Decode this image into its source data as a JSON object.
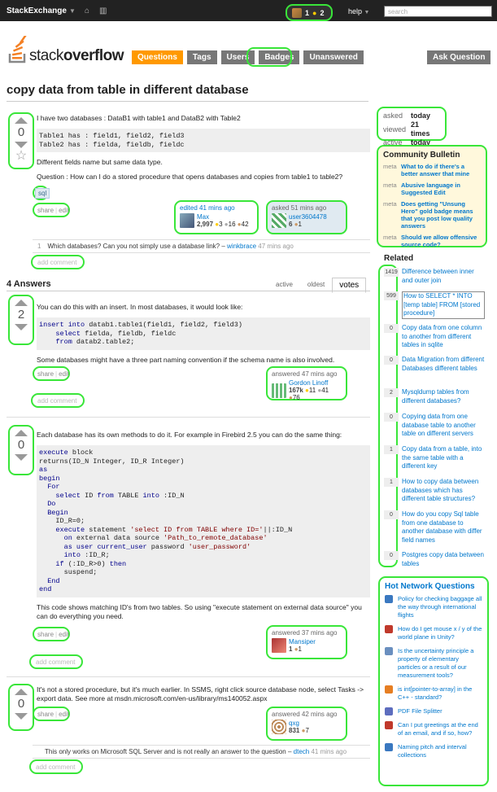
{
  "topbar": {
    "brand": "StackExchange",
    "rep": "1",
    "badges": "2",
    "help": "help",
    "search_placeholder": "search"
  },
  "logo": {
    "prefix": "stack",
    "suffix": "overflow"
  },
  "nav": {
    "questions": "Questions",
    "tags": "Tags",
    "users": "Users",
    "badges": "Badges",
    "unanswered": "Unanswered",
    "ask": "Ask Question"
  },
  "question": {
    "title": "copy data from table in different database",
    "votes": "0",
    "p1": "I have two databases : DataB1 with table1 and DataB2 with Table2",
    "code": "Table1 has : field1, field2, field3\nTable2 has : fielda, fieldb, fieldc",
    "p2": "Different fields name but same data type.",
    "p3": "Question : How can I do a stored procedure that opens databases and copies from table1 to table2?",
    "tag": "sql",
    "share": "share",
    "edit": "edit",
    "edited": {
      "when": "edited 41 mins ago",
      "user": "Max",
      "rep": "2,997",
      "gold": "3",
      "silver": "16",
      "bronze": "42"
    },
    "asked": {
      "when": "asked 51 mins ago",
      "user": "user3604478",
      "rep": "6",
      "bronze": "1"
    },
    "comment": {
      "score": "1",
      "text": "Which databases? Can you not simply use a database link? –",
      "user": "winkbrace",
      "when": "47 mins ago"
    },
    "add_comment": "add comment"
  },
  "answers_header": "4 Answers",
  "tabs": {
    "active": "active",
    "oldest": "oldest",
    "votes": "votes"
  },
  "answers": [
    {
      "votes": "2",
      "p1": "You can do this with an insert. In most databases, it would look like:",
      "p2": "Some databases might have a three part naming convention if the schema name is also involved.",
      "card": {
        "when": "answered 47 mins ago",
        "user": "Gordon Linoff",
        "rep": "167k",
        "gold": "11",
        "silver": "41",
        "bronze": "76"
      }
    },
    {
      "votes": "0",
      "p1": "Each database has its own methods to do it. For example in Firebird 2.5 you can do the same thing:",
      "p2": "This code shows matching ID's from two tables. So using \"execute statement on external data source\" you can do everything you need.",
      "card": {
        "when": "answered 37 mins ago",
        "user": "Mansiper",
        "rep": "1",
        "bronze": "1"
      }
    },
    {
      "votes": "0",
      "p1": "It's not a stored procedure, but it's much earlier. In SSMS, right click source database node, select Tasks -> export data. See more at msdn.microsoft.com/en-us/library/ms140052.aspx",
      "card": {
        "when": "answered 42 mins ago",
        "user": "qxg",
        "rep": "831",
        "bronze": "7"
      },
      "comment": {
        "text": "This only works on Microsoft SQL Server and is not really an answer to the question –",
        "user": "dtech",
        "when": "41 mins ago"
      }
    }
  ],
  "stats": {
    "asked_k": "asked",
    "asked_v": "today",
    "viewed_k": "viewed",
    "viewed_v": "21 times",
    "active_k": "active",
    "active_v": "today"
  },
  "bulletin": {
    "title": "Community Bulletin",
    "items": [
      {
        "meta": "meta",
        "text": "What to do if there's a better answer that mine"
      },
      {
        "meta": "meta",
        "text": "Abusive language in Suggested Edit"
      },
      {
        "meta": "meta",
        "text": "Does getting \"Unsung Hero\" gold badge means that you post low quality answers"
      },
      {
        "meta": "meta",
        "text": "Should we allow offensive source code?"
      }
    ]
  },
  "related": {
    "title": "Related",
    "items": [
      {
        "count": "1419",
        "text": "Difference between inner and outer join"
      },
      {
        "count": "599",
        "text": "How to SELECT * INTO [temp table] FROM [stored procedure]"
      },
      {
        "count": "0",
        "text": "Copy data from one column to another from different tables in sqlite"
      },
      {
        "count": "0",
        "text": "Data Migration from different Databases different tables"
      },
      {
        "count": "2",
        "text": "Mysqldump tables from different databases?"
      },
      {
        "count": "0",
        "text": "Copying data from one database table to another table on different servers"
      },
      {
        "count": "1",
        "text": "Copy data from a table, into the same table with a different key"
      },
      {
        "count": "1",
        "text": "How to copy data between databases which has different table structures?"
      },
      {
        "count": "0",
        "text": "How do you copy Sql table from one database to another database with differ field names"
      },
      {
        "count": "0",
        "text": "Postgres copy data between tables"
      }
    ]
  },
  "hnq": {
    "title": "Hot Network Questions",
    "items": [
      {
        "text": "Policy for checking baggage all the way through international flights",
        "color": "#3a78c0"
      },
      {
        "text": "How do I get mouse x / y of the world plane in Unity?",
        "color": "#c0392b"
      },
      {
        "text": "Is the uncertainty principle a property of elementary particles or a result of our measurement tools?",
        "color": "#6a8fbf"
      },
      {
        "text": "is int[pointer-to-array] in the C++ - standard?",
        "color": "#e67e22"
      },
      {
        "text": "PDF File Splitter",
        "color": "#5d6dbe"
      },
      {
        "text": "Can I put greetings at the end of an email, and if so, how?",
        "color": "#c0392b"
      },
      {
        "text": "Naming pitch and interval collections",
        "color": "#3a78c0"
      }
    ]
  }
}
